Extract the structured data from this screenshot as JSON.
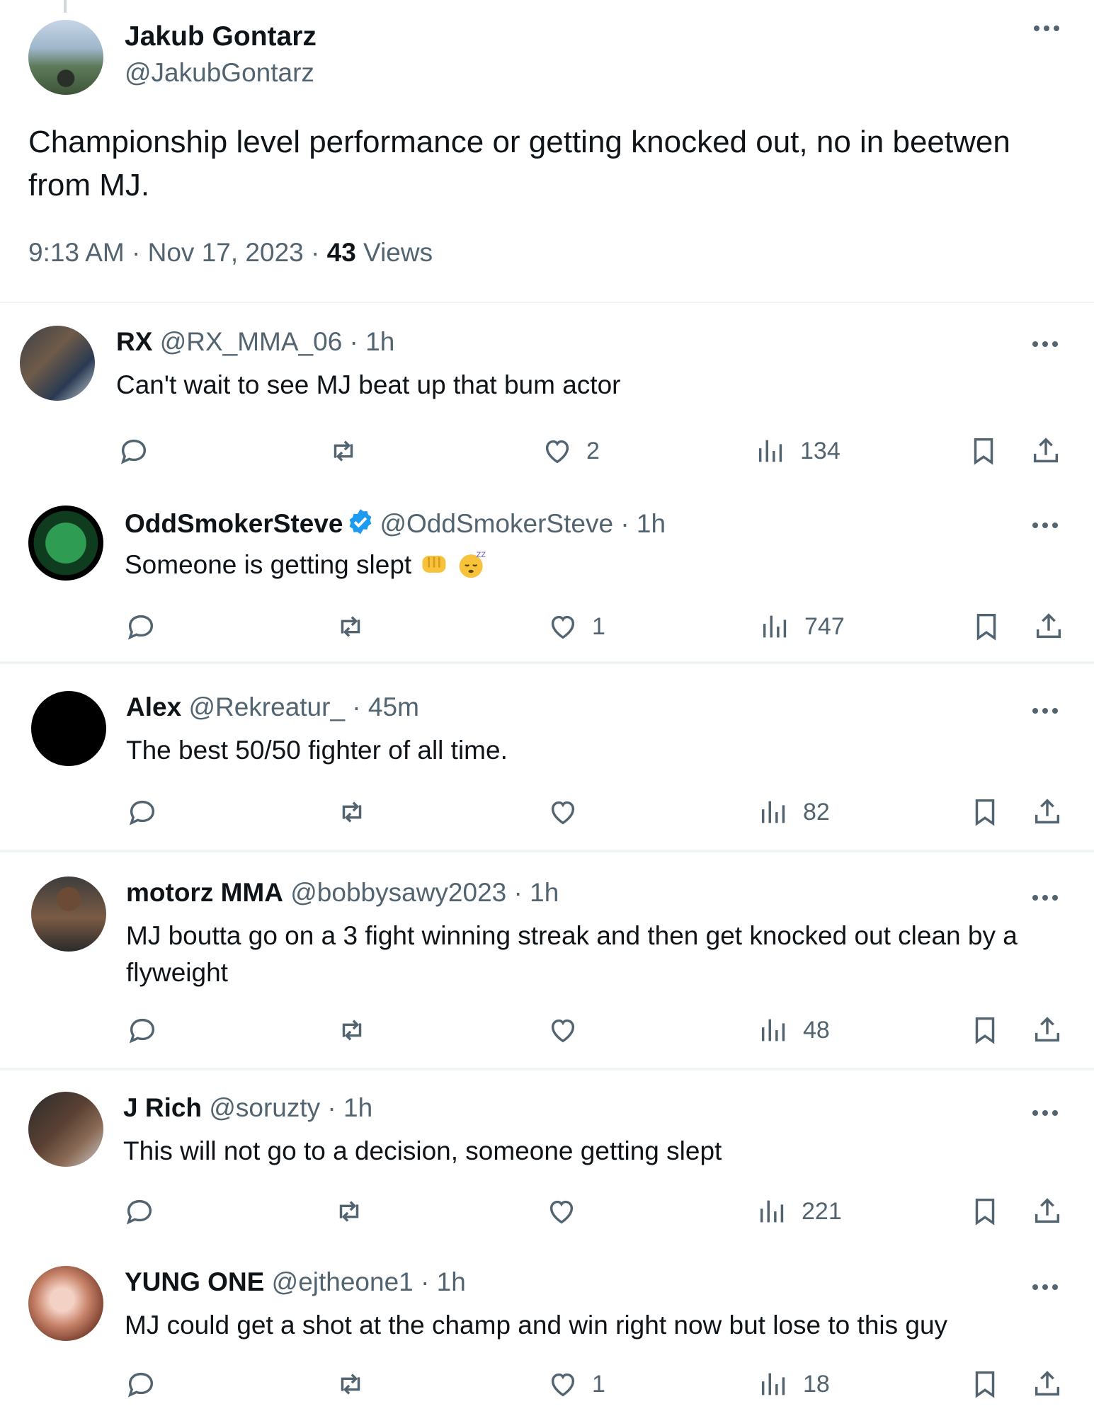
{
  "main_tweet": {
    "name": "Jakub Gontarz",
    "handle": "@JakubGontarz",
    "text": "Championship level performance or getting knocked out, no in beetwen from MJ.",
    "time": "9:13 AM · Nov 17, 2023 · ",
    "views_count": "43",
    "views_label": " Views"
  },
  "replies": [
    {
      "name": "RX",
      "handle": "@RX_MMA_06 · 1h",
      "text": "Can't wait to see MJ beat up that bum actor",
      "likes": "2",
      "views": "134",
      "verified": false
    },
    {
      "name": "OddSmokerSteve",
      "handle": "@OddSmokerSteve · 1h",
      "text": "Someone is getting slept",
      "likes": "1",
      "views": "747",
      "verified": true,
      "emoji": [
        "oncoming-fist-icon",
        "sleeping-face-icon"
      ]
    },
    {
      "name": "Alex",
      "handle": "@Rekreatur_ · 45m",
      "text": "The best 50/50 fighter of all time.",
      "likes": "",
      "views": "82",
      "verified": false
    },
    {
      "name": "motorz MMA",
      "handle": "@bobbysawy2023 · 1h",
      "text": "MJ boutta go on a 3 fight winning streak and then get knocked out clean by a flyweight",
      "likes": "",
      "views": "48",
      "verified": false
    },
    {
      "name": "J Rich",
      "handle": "@soruzty · 1h",
      "text": "This will not go to a decision, someone getting slept",
      "likes": "",
      "views": "221",
      "verified": false
    },
    {
      "name": "YUNG ONE",
      "handle": "@ejtheone1 · 1h",
      "text": "MJ could get a shot at the champ and win right now but lose to this guy",
      "likes": "1",
      "views": "18",
      "verified": false
    }
  ],
  "colors": {
    "text": "#0f1419",
    "secondary": "#536471",
    "divider": "#eff3f4",
    "verified": "#1d9bf0"
  }
}
